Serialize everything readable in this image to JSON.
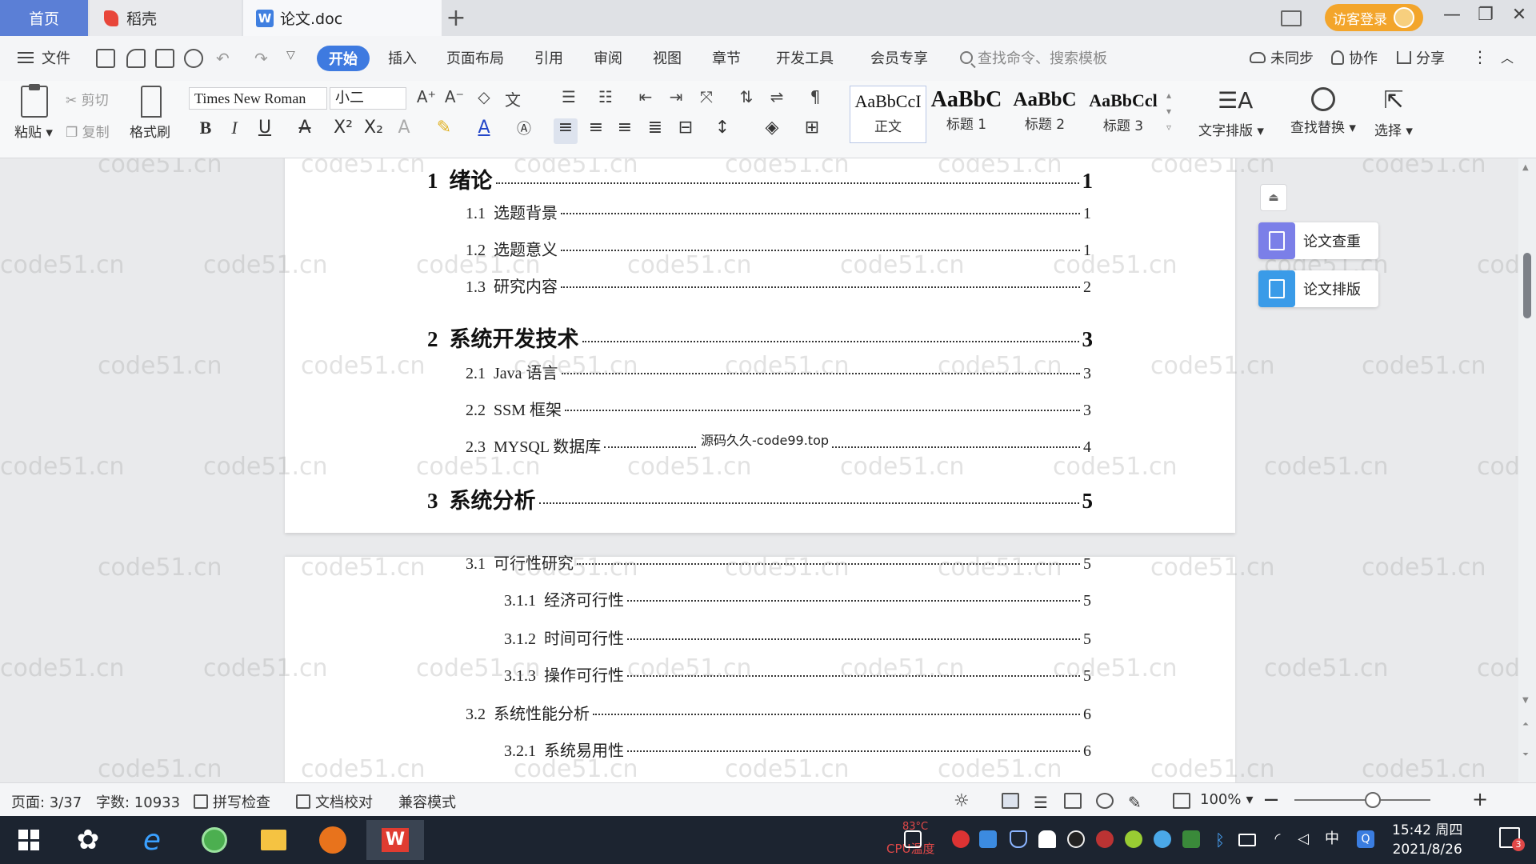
{
  "tabs": {
    "home": "首页",
    "daoke": "稻壳",
    "document": "论文.doc",
    "add": "+"
  },
  "titlebar": {
    "login": "访客登录",
    "minimize": "—",
    "restore": "❐",
    "close": "✕"
  },
  "menu": {
    "file": "文件",
    "items": [
      "开始",
      "插入",
      "页面布局",
      "引用",
      "审阅",
      "视图",
      "章节",
      "开发工具",
      "会员专享"
    ],
    "active": "开始",
    "search_placeholder": "查找命令、搜索模板",
    "sync": "未同步",
    "collab": "协作",
    "share": "分享"
  },
  "ribbon": {
    "paste": "粘贴",
    "cut": "剪切",
    "copy": "复制",
    "format_painter": "格式刷",
    "font_name": "Times New Roman",
    "font_size": "小二",
    "styles": [
      {
        "sample": "AaBbCcI",
        "name": "正文"
      },
      {
        "sample": "AaBbC",
        "name": "标题 1"
      },
      {
        "sample": "AaBbC",
        "name": "标题 2"
      },
      {
        "sample": "AaBbCcl",
        "name": "标题 3"
      }
    ],
    "text_layout": "文字排版",
    "find_replace": "查找替换",
    "select": "选择"
  },
  "toc": [
    {
      "level": 1,
      "number": "1",
      "title": "绪论",
      "page": "1"
    },
    {
      "level": 2,
      "number": "1.1",
      "title": "选题背景",
      "page": "1"
    },
    {
      "level": 2,
      "number": "1.2",
      "title": "选题意义",
      "page": "1"
    },
    {
      "level": 2,
      "number": "1.3",
      "title": "研究内容",
      "page": "2"
    },
    {
      "level": 1,
      "number": "2",
      "title": "系统开发技术",
      "page": "3"
    },
    {
      "level": 2,
      "number": "2.1",
      "title": "Java 语言",
      "page": "3"
    },
    {
      "level": 2,
      "number": "2.2",
      "title": "SSM 框架",
      "page": "3"
    },
    {
      "level": 2,
      "number": "2.3",
      "title": "MYSQL 数据库",
      "page": "4"
    },
    {
      "level": 1,
      "number": "3",
      "title": "系统分析",
      "page": "5"
    },
    {
      "level": 2,
      "number": "3.1",
      "title": "可行性研究",
      "page": "5"
    },
    {
      "level": 3,
      "number": "3.1.1",
      "title": "经济可行性",
      "page": "5"
    },
    {
      "level": 3,
      "number": "3.1.2",
      "title": "时间可行性",
      "page": "5"
    },
    {
      "level": 3,
      "number": "3.1.3",
      "title": "操作可行性",
      "page": "5"
    },
    {
      "level": 2,
      "number": "3.2",
      "title": "系统性能分析",
      "page": "6"
    },
    {
      "level": 3,
      "number": "3.2.1",
      "title": "系统易用性",
      "page": "6"
    }
  ],
  "overlay_text": "源码久久-code99.top",
  "watermark": "code51.cn",
  "side_panel": {
    "check": "论文查重",
    "format": "论文排版"
  },
  "status": {
    "page": "页面: 3/37",
    "words": "字数: 10933",
    "spell": "拼写检查",
    "proof": "文档校对",
    "compat": "兼容模式",
    "zoom": "100%",
    "zoom_minus": "—",
    "zoom_plus": "+"
  },
  "taskbar": {
    "cpu_temp": "83°C",
    "cpu_label": "CPU温度",
    "time": "15:42 周四",
    "date": "2021/8/26",
    "ime": "中",
    "notif_count": "3"
  },
  "colors": {
    "accent": "#3e7ae0",
    "login": "#f3a52b",
    "side_check": "#7b7fe8",
    "side_format": "#3a9be8"
  }
}
